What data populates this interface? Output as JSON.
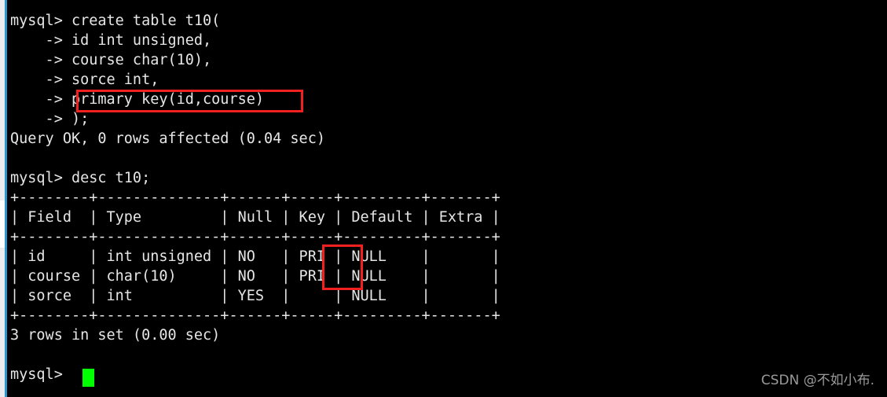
{
  "window": {
    "kind": "terminal",
    "background_color": "#000000",
    "text_color": "#e6e6e6",
    "accent_color": "#2e95d3",
    "annotation_color": "#f32020",
    "cursor_color": "#00ff00"
  },
  "terminal": {
    "prompt": "mysql>",
    "continuation_prompt": "->",
    "console_text": "mysql> create table t10(\n    -> id int unsigned,\n    -> course char(10),\n    -> sorce int,\n    -> primary key(id,course)\n    -> );\nQuery OK, 0 rows affected (0.04 sec)\n\nmysql> desc t10;\n+--------+--------------+------+-----+---------+-------+\n| Field  | Type         | Null | Key | Default | Extra |\n+--------+--------------+------+-----+---------+-------+\n| id     | int unsigned | NO   | PRI | NULL    |       |\n| course | char(10)     | NO   | PRI | NULL    |       |\n| sorce  | int          | YES  |     | NULL    |       |\n+--------+--------------+------+-----+---------+-------+\n3 rows in set (0.00 sec)\n\nmysql> ",
    "commands": [
      {
        "statement_lines": [
          "mysql> create table t10(",
          "    -> id int unsigned,",
          "    -> course char(10),",
          "    -> sorce int,",
          "    -> primary key(id,course)",
          "    -> );"
        ],
        "result": "Query OK, 0 rows affected (0.04 sec)"
      },
      {
        "statement_lines": [
          "mysql> desc t10;"
        ],
        "result": "3 rows in set (0.00 sec)"
      }
    ],
    "desc_table": {
      "separator": "+--------+--------------+------+-----+---------+-------+",
      "columns": [
        "Field",
        "Type",
        "Null",
        "Key",
        "Default",
        "Extra"
      ],
      "rows": [
        {
          "Field": "id",
          "Type": "int unsigned",
          "Null": "NO",
          "Key": "PRI",
          "Default": "NULL",
          "Extra": ""
        },
        {
          "Field": "course",
          "Type": "char(10)",
          "Null": "NO",
          "Key": "PRI",
          "Default": "NULL",
          "Extra": ""
        },
        {
          "Field": "sorce",
          "Type": "int",
          "Null": "YES",
          "Key": "",
          "Default": "NULL",
          "Extra": ""
        }
      ],
      "row_count_text": "3 rows in set (0.00 sec)"
    },
    "final_prompt": "mysql>"
  },
  "annotations": [
    {
      "id": "primary-key-clause",
      "label": "primary key(id,course)",
      "color": "#f32020"
    },
    {
      "id": "pri-key-column",
      "label": "PRI",
      "color": "#f32020"
    }
  ],
  "watermark": {
    "text": "CSDN @不如小布."
  }
}
